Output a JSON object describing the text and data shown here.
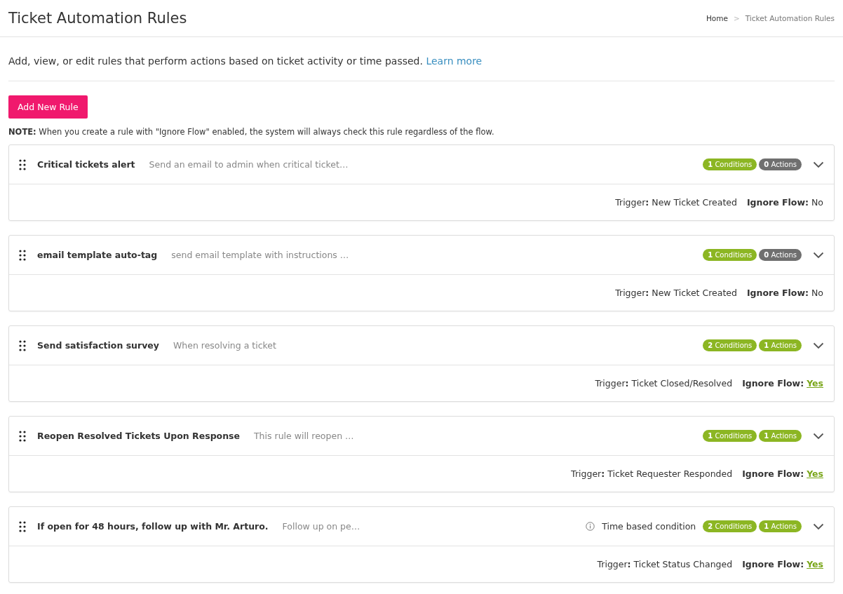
{
  "header": {
    "title": "Ticket Automation Rules",
    "breadcrumb": [
      {
        "label": "Home",
        "current": false
      },
      {
        "label": "Ticket Automation Rules",
        "current": true
      }
    ],
    "separator": ">"
  },
  "intro": {
    "text": "Add, view, or edit rules that perform actions based on ticket activity or time passed.",
    "link": "Learn more"
  },
  "add_button": "Add New Rule",
  "note": "**NOTE:** When you create a rule with \"Ignore Flow\" enabled, the system will always check this rule regardless of the flow.",
  "rules": [
    {
      "name": "Critical tickets alert",
      "description": "Send an email to admin when critical ticket…",
      "badges": [
        {
          "text": "**1** Conditions",
          "color": "#8cb623"
        },
        {
          "text": "**0** Actions",
          "color": "#6f6f6f"
        }
      ],
      "trigger": "Trigger**:** New Ticket Created",
      "ignore_flow": {
        "label": "Ignore Flow:",
        "value": "No",
        "on": false
      }
    },
    {
      "name": "email template auto-tag",
      "description": "send email template with instructions …",
      "badges": [
        {
          "text": "**1** Conditions",
          "color": "#8cb623"
        },
        {
          "text": "**0** Actions",
          "color": "#6f6f6f"
        }
      ],
      "trigger": "Trigger**:** New Ticket Created",
      "ignore_flow": {
        "label": "Ignore Flow:",
        "value": "No",
        "on": false
      }
    },
    {
      "name": "Send satisfaction survey",
      "description": "When resolving a ticket",
      "badges": [
        {
          "text": "**2** Conditions",
          "color": "#8cb623"
        },
        {
          "text": "**1** Actions",
          "color": "#8cb623"
        }
      ],
      "trigger": "Trigger**:** Ticket Closed/Resolved",
      "ignore_flow": {
        "label": "Ignore Flow:",
        "value": "Yes",
        "on": true
      }
    },
    {
      "name": "Reopen Resolved Tickets Upon Response",
      "description": "This rule will reopen …",
      "badges": [
        {
          "text": "**1** Conditions",
          "color": "#8cb623"
        },
        {
          "text": "**1** Actions",
          "color": "#8cb623"
        }
      ],
      "trigger": "Trigger**:** Ticket Requester Responded",
      "ignore_flow": {
        "label": "Ignore Flow:",
        "value": "Yes",
        "on": true
      }
    },
    {
      "name": "If open for 48 hours, follow up with Mr. Arturo.",
      "description": "Follow up on pe…",
      "time_based": "Time based condition",
      "badges": [
        {
          "text": "**2** Conditions",
          "color": "#8cb623"
        },
        {
          "text": "**1** Actions",
          "color": "#8cb623"
        }
      ],
      "trigger": "Trigger**:** Ticket Status Changed",
      "ignore_flow": {
        "label": "Ignore Flow:",
        "value": "Yes",
        "on": true
      }
    }
  ]
}
